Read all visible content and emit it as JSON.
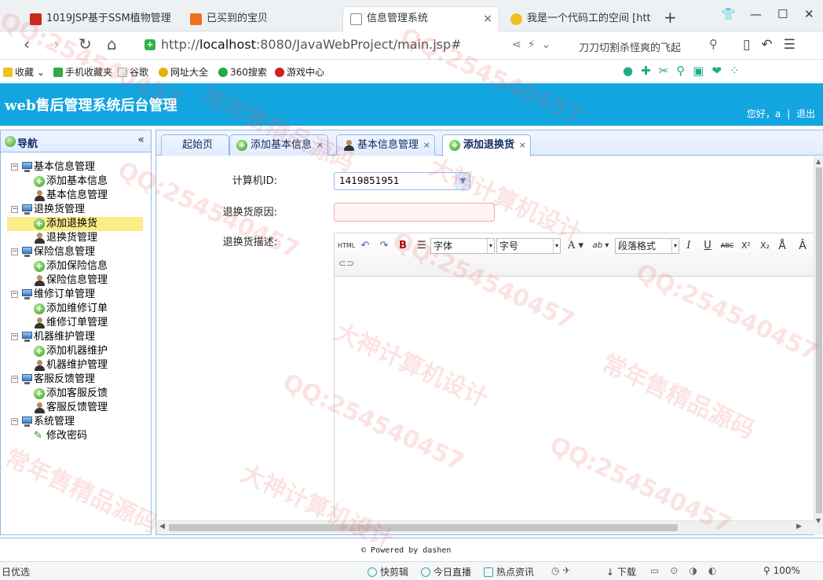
{
  "browser": {
    "tabs": [
      {
        "title": "1019JSP基于SSM植物管理",
        "icon_color": "#c8281e",
        "active": false
      },
      {
        "title": "已买到的宝贝",
        "icon_color": "#f07020",
        "active": false
      },
      {
        "title": "信息管理系统",
        "icon_color": "#ffffff",
        "active": true
      },
      {
        "title": "我是一个代码工的空间 [htt",
        "icon_color": "#f0c020",
        "active": false
      }
    ],
    "tab_close": "×",
    "new_tab": "+",
    "url_prefix": "http://",
    "url_host": "localhost",
    "url_rest": ":8080/JavaWebProject/main.jsp#",
    "search_text": "刀刀切割杀怪爽的飞起",
    "bookmarks": [
      {
        "label": "收藏",
        "icon_color": "#f0c020"
      },
      {
        "label": "手机收藏夹",
        "icon_color": "#33aa44"
      },
      {
        "label": "谷歌",
        "icon_color": "#dddddd"
      },
      {
        "label": "网址大全",
        "icon_color": "#e8b000"
      },
      {
        "label": "360搜索",
        "icon_color": "#28a745"
      },
      {
        "label": "游戏中心",
        "icon_color": "#d02020"
      }
    ],
    "status": [
      {
        "label": "日优选"
      },
      {
        "label": "快剪辑"
      },
      {
        "label": "今日直播"
      },
      {
        "label": "热点资讯"
      },
      {
        "label": "下载"
      },
      {
        "label": "100%"
      }
    ]
  },
  "app": {
    "title": "web售后管理系统后台管理",
    "greeting": "您好，a",
    "separator": "|",
    "logout": "退出",
    "header_color": "#12a5e0"
  },
  "nav": {
    "title": "导航",
    "collapse": "«",
    "groups": [
      {
        "label": "基本信息管理",
        "items": [
          {
            "label": "添加基本信息",
            "icon": "plus-icon"
          },
          {
            "label": "基本信息管理",
            "icon": "person-icon"
          }
        ]
      },
      {
        "label": "退换货管理",
        "items": [
          {
            "label": "添加退换货",
            "icon": "plus-icon",
            "selected": true
          },
          {
            "label": "退换货管理",
            "icon": "person-icon"
          }
        ]
      },
      {
        "label": "保险信息管理",
        "items": [
          {
            "label": "添加保险信息",
            "icon": "plus-icon"
          },
          {
            "label": "保险信息管理",
            "icon": "person-icon"
          }
        ]
      },
      {
        "label": "维修订单管理",
        "items": [
          {
            "label": "添加维修订单",
            "icon": "plus-icon"
          },
          {
            "label": "维修订单管理",
            "icon": "person-icon"
          }
        ]
      },
      {
        "label": "机器维护管理",
        "items": [
          {
            "label": "添加机器维护",
            "icon": "plus-icon"
          },
          {
            "label": "机器维护管理",
            "icon": "person-icon"
          }
        ]
      },
      {
        "label": "客服反馈管理",
        "items": [
          {
            "label": "添加客服反馈",
            "icon": "plus-icon"
          },
          {
            "label": "客服反馈管理",
            "icon": "person-icon"
          }
        ]
      },
      {
        "label": "系统管理",
        "items": [
          {
            "label": "修改密码",
            "icon": "pencil-icon"
          }
        ]
      }
    ]
  },
  "main": {
    "tabs": [
      {
        "label": "起始页",
        "icon": "none",
        "closable": false
      },
      {
        "label": "添加基本信息",
        "icon": "plus-icon",
        "closable": true
      },
      {
        "label": "基本信息管理",
        "icon": "person-icon",
        "closable": true
      },
      {
        "label": "添加退换货",
        "icon": "plus-icon",
        "closable": true,
        "active": true
      }
    ],
    "tab_close": "×",
    "form": {
      "computer_id_label": "计算机ID:",
      "computer_id_value": "1419851951",
      "reason_label": "退换货原因:",
      "reason_value": "",
      "desc_label": "退换货描述:"
    },
    "editor_toolbar": {
      "html": "HTML",
      "undo": "↶",
      "redo": "↷",
      "bold": "B",
      "font_family": "字体",
      "font_size": "字号",
      "font_color": "A",
      "highlight": "ab",
      "paragraph": "段落格式",
      "italic": "I",
      "underline": "U",
      "strike": "ABC",
      "superscript": "X²",
      "subscript": "X₂"
    }
  },
  "footer": {
    "text": "Powered by dashen"
  },
  "watermarks": [
    "QQ:254540457",
    "大神计算机设计",
    "常年售精品源码"
  ]
}
